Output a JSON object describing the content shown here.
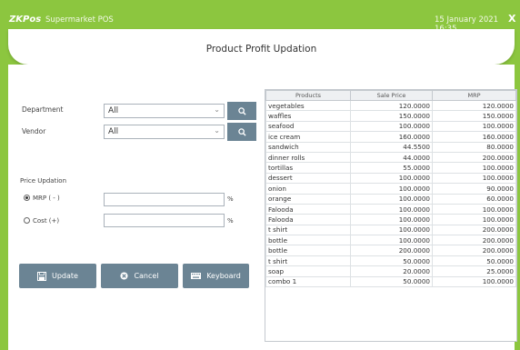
{
  "titlebar": {
    "logo": "ZKPos",
    "app_title": "Supermarket POS",
    "datetime": "15 January 2021 16:35",
    "close": "X"
  },
  "page_title": "Product Profit Updation",
  "filters": {
    "department_label": "Department",
    "department_value": "All",
    "vendor_label": "Vendor",
    "vendor_value": "All"
  },
  "price_updation": {
    "heading": "Price Updation",
    "mrp_label": "MRP ( - )",
    "cost_label": "Cost (+)",
    "mrp_value": "",
    "cost_value": "",
    "percent": "%"
  },
  "buttons": {
    "update": "Update",
    "cancel": "Cancel",
    "keyboard": "Keyboard"
  },
  "table": {
    "columns": [
      "Products",
      "Sale Price",
      "MRP"
    ],
    "rows": [
      [
        "vegetables",
        "120.0000",
        "120.0000"
      ],
      [
        "waffles",
        "150.0000",
        "150.0000"
      ],
      [
        "seafood",
        "100.0000",
        "100.0000"
      ],
      [
        "ice cream",
        "160.0000",
        "160.0000"
      ],
      [
        "sandwich",
        "44.5500",
        "80.0000"
      ],
      [
        "dinner rolls",
        "44.0000",
        "200.0000"
      ],
      [
        "tortillas",
        "55.0000",
        "100.0000"
      ],
      [
        "dessert",
        "100.0000",
        "100.0000"
      ],
      [
        "onion",
        "100.0000",
        "90.0000"
      ],
      [
        "orange",
        "100.0000",
        "60.0000"
      ],
      [
        "Falooda",
        "100.0000",
        "100.0000"
      ],
      [
        "Falooda",
        "100.0000",
        "100.0000"
      ],
      [
        "t shirt",
        "100.0000",
        "200.0000"
      ],
      [
        "bottle",
        "100.0000",
        "200.0000"
      ],
      [
        "bottle",
        "200.0000",
        "200.0000"
      ],
      [
        "t shirt",
        "50.0000",
        "50.0000"
      ],
      [
        "soap",
        "20.0000",
        "25.0000"
      ],
      [
        "combo 1",
        "50.0000",
        "100.0000"
      ]
    ]
  }
}
